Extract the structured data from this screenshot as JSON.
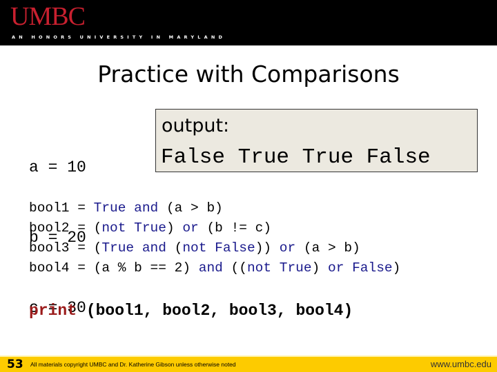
{
  "header": {
    "logo": "UMBC",
    "tagline": "AN HONORS UNIVERSITY IN MARYLAND",
    "background_color": "#000000",
    "logo_color": "#c8202f"
  },
  "slide": {
    "title": "Practice with Comparisons",
    "variables": [
      "a = 10",
      "b = 20",
      "c = 30"
    ],
    "output_box": {
      "label": "output:",
      "value": "False True True False"
    },
    "code_lines": [
      [
        {
          "t": "bool1 = ",
          "k": false
        },
        {
          "t": "True",
          "k": true
        },
        {
          "t": " ",
          "k": false
        },
        {
          "t": "and",
          "k": true
        },
        {
          "t": " (a > b)",
          "k": false
        }
      ],
      [
        {
          "t": "bool2 = (",
          "k": false
        },
        {
          "t": "not",
          "k": true
        },
        {
          "t": " ",
          "k": false
        },
        {
          "t": "True",
          "k": true
        },
        {
          "t": ") ",
          "k": false
        },
        {
          "t": "or",
          "k": true
        },
        {
          "t": " (b != c)",
          "k": false
        }
      ],
      [
        {
          "t": "bool3 = (",
          "k": false
        },
        {
          "t": "True",
          "k": true
        },
        {
          "t": " ",
          "k": false
        },
        {
          "t": "and",
          "k": true
        },
        {
          "t": " (",
          "k": false
        },
        {
          "t": "not",
          "k": true
        },
        {
          "t": " ",
          "k": false
        },
        {
          "t": "False",
          "k": true
        },
        {
          "t": ")) ",
          "k": false
        },
        {
          "t": "or",
          "k": true
        },
        {
          "t": " (a > b)",
          "k": false
        }
      ],
      [
        {
          "t": "bool4 = (a % b == 2) ",
          "k": false
        },
        {
          "t": "and",
          "k": true
        },
        {
          "t": " ((",
          "k": false
        },
        {
          "t": "not",
          "k": true
        },
        {
          "t": " ",
          "k": false
        },
        {
          "t": "True",
          "k": true
        },
        {
          "t": ") ",
          "k": false
        },
        {
          "t": "or",
          "k": true
        },
        {
          "t": " ",
          "k": false
        },
        {
          "t": "False",
          "k": true
        },
        {
          "t": ")",
          "k": false
        }
      ]
    ],
    "print_statement": {
      "keyword": "print",
      "args": " (bool1, bool2, bool3, bool4)"
    },
    "colors": {
      "keyword": "#1a1a8c",
      "print_keyword": "#9b1b1b",
      "output_background": "#ece9e0"
    }
  },
  "footer": {
    "slide_number": "53",
    "copyright": "All materials copyright UMBC and Dr. Katherine Gibson unless otherwise noted",
    "url": "www.umbc.edu",
    "background_color": "#fdcb00"
  }
}
